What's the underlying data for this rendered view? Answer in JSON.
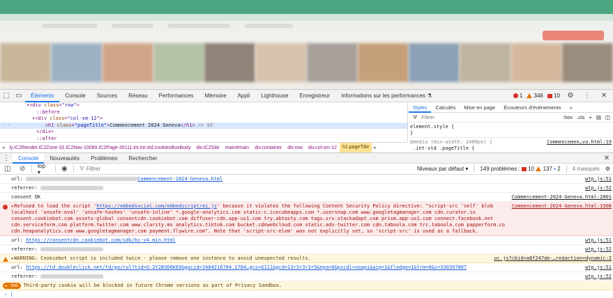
{
  "devtools": {
    "tabs": [
      "Éléments",
      "Console",
      "Sources",
      "Réseau",
      "Performances",
      "Mémoire",
      "Appli",
      "Lighthouse",
      "Enregistreur",
      "Informations sur les performances"
    ],
    "counts": {
      "errors": "1",
      "warnings": "346",
      "issues": "10"
    }
  },
  "elements": {
    "lines": [
      {
        "open": "<div ",
        "attr": "class",
        "val": "\"row\"",
        "close": ">"
      },
      {
        "pseudo": "::before"
      },
      {
        "open": "<div ",
        "attr": "class",
        "val": "\"col-sm-12\"",
        "close": ">"
      },
      {
        "open": "<h1 ",
        "attr": "class",
        "val": "\"pageTitle\"",
        "close": ">",
        "text": "Commencement 2024 Geneva",
        "end": "</h1>",
        "dollar": " == $0"
      },
      {
        "plain": "</div>"
      },
      {
        "pseudo": "::after"
      }
    ],
    "breadcrumbs": [
      "ly.IC2Render.IC2Zone-32.IC2Nav-10089.IC2Page-35111.int.int-std.cookiesBoxBody",
      "div.IC2Site",
      "main#main",
      "div.container",
      "div.row",
      "div.col-sm-12",
      "h1.pageTitle"
    ]
  },
  "styles": {
    "tabs": [
      "Styles",
      "Calculés",
      "Mise en page",
      "Écouteurs d'événements"
    ],
    "filter_placeholder": "Filtrer",
    "hov": ":hov",
    "cls": ".cls",
    "element_style": "element.style {",
    "brace": "}",
    "media": "@media (min-width: 1400px) {",
    "media_source": "Commencemen…va.html:19",
    "selector": ".int-std .pageTitle {"
  },
  "drawer": {
    "tabs": [
      "Console",
      "Nouveautés",
      "Problèmes",
      "Rechercher"
    ],
    "context": "top",
    "filter_placeholder": "Filtrer",
    "levels": "Niveaux par défaut",
    "problems": "149 problèmes :",
    "problem_counts": {
      "errors": "10",
      "warnings": "137",
      "info": "2"
    },
    "hidden": "4 masqués"
  },
  "console": {
    "messages": [
      {
        "prefix": "url:",
        "link": "Commencement-2024-Geneva.html",
        "src": "wtp.js:51"
      },
      {
        "prefix": "referrer:",
        "src": "wtp.js:52"
      },
      {
        "prefix": "consent OK",
        "src": "Commencement-2024-Geneva.html:2801"
      },
      {
        "prefix": "Refused to load the script '",
        "link": "https://embedsocial.com/embedscript/ei.js",
        "suffix": "' because it violates the following Content Security Policy directive: \"script-src 'self' blob localhost 'unsafe-eval' 'unsafe-hashes' 'unsafe-inline' *.google-analytics.com static-c.icecubeapps.com *.usersnap.com www.googletagmanager.com cdn.curator.io consent.cookiebot.com assets-global consentcdn.cookiebot.com diffuser-cdn.app-us1.com try.abtasty.com tags.srv.stackadapt.com prism.app-us1.com connect.facebook.net cdn.serviceform.com platform.twitter.com www.clarity.ms analytics.tiktok.com bucket.cdnwebcloud.com static.ads-twitter.com cdn.taboola.com trc.taboola.com papperform.co cdn.heapanalytics.com www.googletagmanager.com payment.flywire.com\". Note that 'script-src-elem' was not explicitly set, so 'script-src' is used as a fallback.",
        "src": "Commencement-2024-Geneva.html:3308"
      },
      {
        "prefix": "url:",
        "link": "https://consentcdn.cookiebot.com/sdk/bc-v4.min.html",
        "src": "wtp.js:51"
      },
      {
        "prefix": "referrer:",
        "src": "wtp.js:52"
      },
      {
        "prefix": "WARNING: Cookiebot script is included twice - please remove one instance to avoid unexpected results.",
        "src": "uc.js?cbid=a8f247de-…redaction=dynamic:2"
      },
      {
        "prefix": "url:",
        "link": "https://td.doubleclick.net/td/ga/rul?tid=G-2Y2B3D6KE0&gacid=1484216704.1704…gcs=G111&gcd=13r3r3r3r5&npa=0&pscdl=noapi&aip=1&fledge=1&frm=0&z=330397807",
        "src": "wtp.js:51"
      },
      {
        "prefix": "referrer:",
        "src": "wtp.js:52"
      },
      {
        "count": "345",
        "prefix": "Third-party cookie will be blocked in future Chrome versions as part of Privacy Sandbox."
      }
    ]
  }
}
